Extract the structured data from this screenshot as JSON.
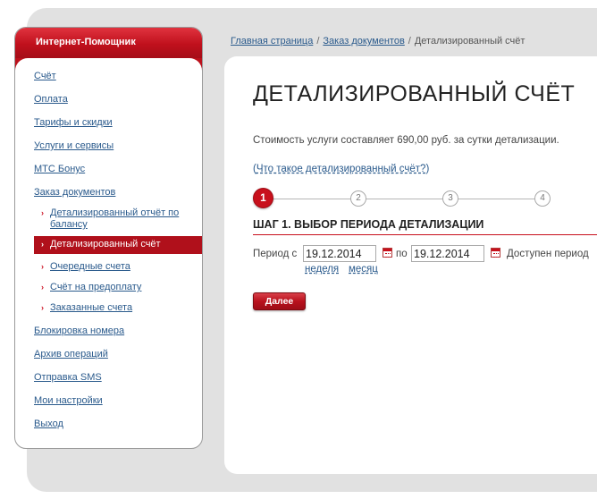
{
  "sidebar": {
    "title": "Интернет-Помощник",
    "items": [
      {
        "label": "Счёт"
      },
      {
        "label": "Оплата"
      },
      {
        "label": "Тарифы и скидки"
      },
      {
        "label": "Услуги и сервисы"
      },
      {
        "label": "МТС Бонус"
      },
      {
        "label": "Заказ документов"
      }
    ],
    "subitems": [
      {
        "label": "Детализированный отчёт по балансу",
        "active": false
      },
      {
        "label": "Детализированный счёт",
        "active": true
      },
      {
        "label": "Очередные счета",
        "active": false
      },
      {
        "label": "Счёт на предоплату",
        "active": false
      },
      {
        "label": "Заказанные счета",
        "active": false
      }
    ],
    "items_after": [
      {
        "label": "Блокировка номера"
      },
      {
        "label": "Архив операций"
      },
      {
        "label": "Отправка SMS"
      },
      {
        "label": "Мои настройки"
      },
      {
        "label": "Выход"
      }
    ]
  },
  "breadcrumb": {
    "home": "Главная страница",
    "section": "Заказ документов",
    "current": "Детализированный счёт",
    "separator": "/"
  },
  "main": {
    "title": "ДЕТАЛИЗИРОВАННЫЙ СЧЁТ",
    "cost_text": "Стоимость услуги составляет 690,00 руб. за сутки детализации.",
    "what_link_open": "(",
    "what_link": "Что такое детализированный счёт?",
    "what_link_close": ")",
    "steps": [
      "1",
      "2",
      "3",
      "4"
    ],
    "active_step": 1,
    "step_heading": "ШАГ 1. ВЫБОР ПЕРИОДА ДЕТАЛИЗАЦИИ",
    "period_from_label": "Период с",
    "date_from": "19.12.2014",
    "period_to_label": "по",
    "date_to": "19.12.2014",
    "available_label": "Доступен период",
    "quick_week": "неделя",
    "quick_month": "месяц",
    "next_button": "Далее"
  },
  "colors": {
    "accent": "#c8101c",
    "link": "#2a5a8c",
    "panel_bg": "#e1e1e1"
  }
}
